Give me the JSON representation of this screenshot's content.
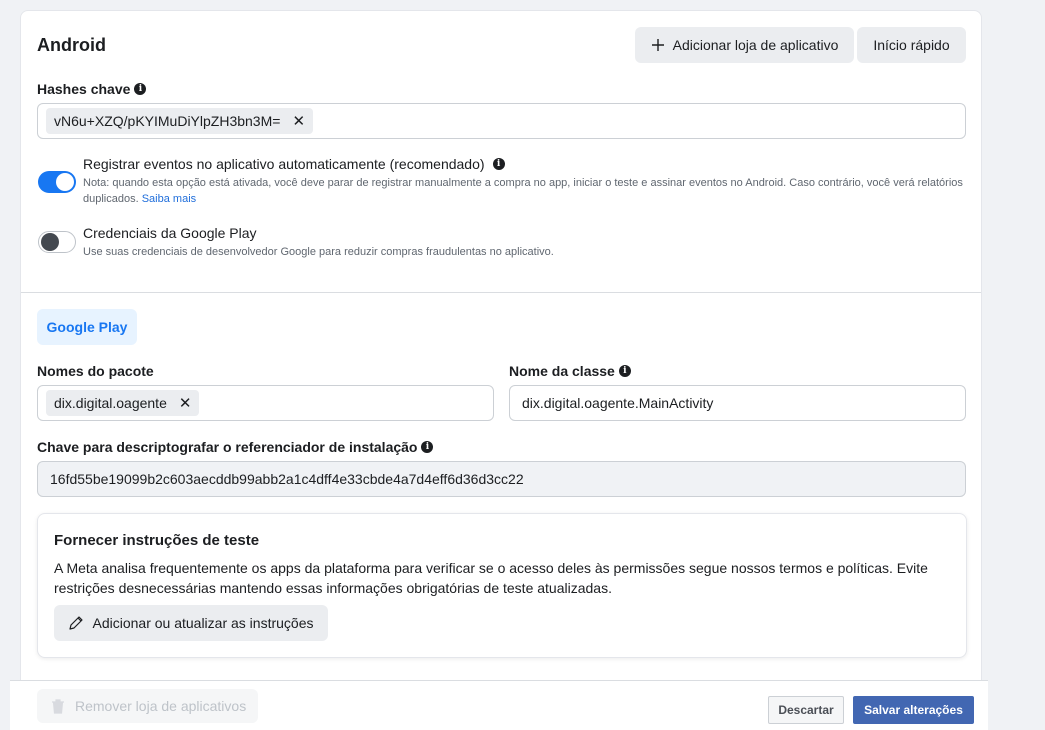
{
  "header": {
    "title": "Android",
    "add_store_label": "Adicionar loja de aplicativo",
    "quick_start_label": "Início rápido"
  },
  "key_hashes": {
    "label": "Hashes chave",
    "chip_value": "vN6u+XZQ/pKYIMuDiYlpZH3bn3M="
  },
  "auto_log": {
    "title": "Registrar eventos no aplicativo automaticamente (recomendado)",
    "note": "Nota: quando esta opção está ativada, você deve parar de registrar manualmente a compra no app, iniciar o teste e assinar eventos no Android. Caso contrário, você verá relatórios duplicados.",
    "link": "Saiba mais",
    "enabled": true
  },
  "google_play_credentials": {
    "title": "Credenciais da Google Play",
    "note": "Use suas credenciais de desenvolvedor Google para reduzir compras fraudulentas no aplicativo.",
    "enabled": false
  },
  "store_tab": {
    "label": "Google Play"
  },
  "package_names": {
    "label": "Nomes do pacote",
    "chip_value": "dix.digital.oagente"
  },
  "class_name": {
    "label": "Nome da classe",
    "value": "dix.digital.oagente.MainActivity"
  },
  "decrypt_key": {
    "label": "Chave para descriptografar o referenciador de instalação",
    "value": "16fd55be19099b2c603aecddb99abb2a1c4dff4e33cbde4a7d4eff6d36d3cc22"
  },
  "test_instructions": {
    "title": "Fornecer instruções de teste",
    "description": "A Meta analisa frequentemente os apps da plataforma para verificar se o acesso deles às permissões segue nossos termos e políticas. Evite restrições desnecessárias mantendo essas informações obrigatórias de teste atualizadas.",
    "button_label": "Adicionar ou atualizar as instruções"
  },
  "footer": {
    "remove_label": "Remover loja de aplicativos",
    "discard_label": "Descartar",
    "save_label": "Salvar alterações"
  },
  "colors": {
    "accent": "#1877f2",
    "save_button": "#4267b2",
    "chip_bg": "#ebedf0"
  },
  "icons": {
    "info": "info-icon",
    "plus": "plus-icon",
    "close": "close-icon",
    "pencil": "pencil-icon",
    "trash": "trash-icon"
  }
}
